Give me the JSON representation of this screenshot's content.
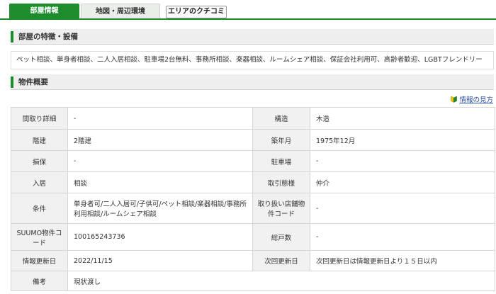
{
  "tabs": {
    "room_info": "部屋情報",
    "map": "地図・周辺環境",
    "review": "エリアのクチコミ"
  },
  "features_section": {
    "title": "部屋の特徴・設備",
    "text": "ペット相談、単身者相談、二人入居相談、駐車場2台無料、事務所相談、楽器相談、ルームシェア相談、保証会社利用可、高齢者歓迎、LGBTフレンドリー"
  },
  "overview_section": {
    "title": "物件概要",
    "guide_link": "情報の見方"
  },
  "table": {
    "rows": [
      {
        "l1": "間取り詳細",
        "v1": "-",
        "l2": "構造",
        "v2": "木造"
      },
      {
        "l1": "階建",
        "v1": "2階建",
        "l2": "築年月",
        "v2": "1975年12月"
      },
      {
        "l1": "損保",
        "v1": "-",
        "l2": "駐車場",
        "v2": "-"
      },
      {
        "l1": "入居",
        "v1": "相談",
        "l2": "取引態様",
        "v2": "仲介"
      },
      {
        "l1": "条件",
        "v1": "単身者可/二人入居可/子供可/ペット相談/楽器相談/事務所利用相談/ルームシェア相談",
        "l2": "取り扱い店舗物件コード",
        "v2": "-"
      },
      {
        "l1": "SUUMO物件コード",
        "v1": "100165243736",
        "l2": "総戸数",
        "v2": "-"
      },
      {
        "l1": "情報更新日",
        "v1": "2022/11/15",
        "l2": "次回更新日",
        "v2": "次回更新日は情報更新日より１５日以内"
      },
      {
        "l1": "備考",
        "v1": "現状渡し"
      }
    ]
  },
  "colors": {
    "accent": "#1c8c2c",
    "header_bg": "#eeeeee",
    "label_bg": "#f1f1f1",
    "link": "#2a4f9b"
  }
}
